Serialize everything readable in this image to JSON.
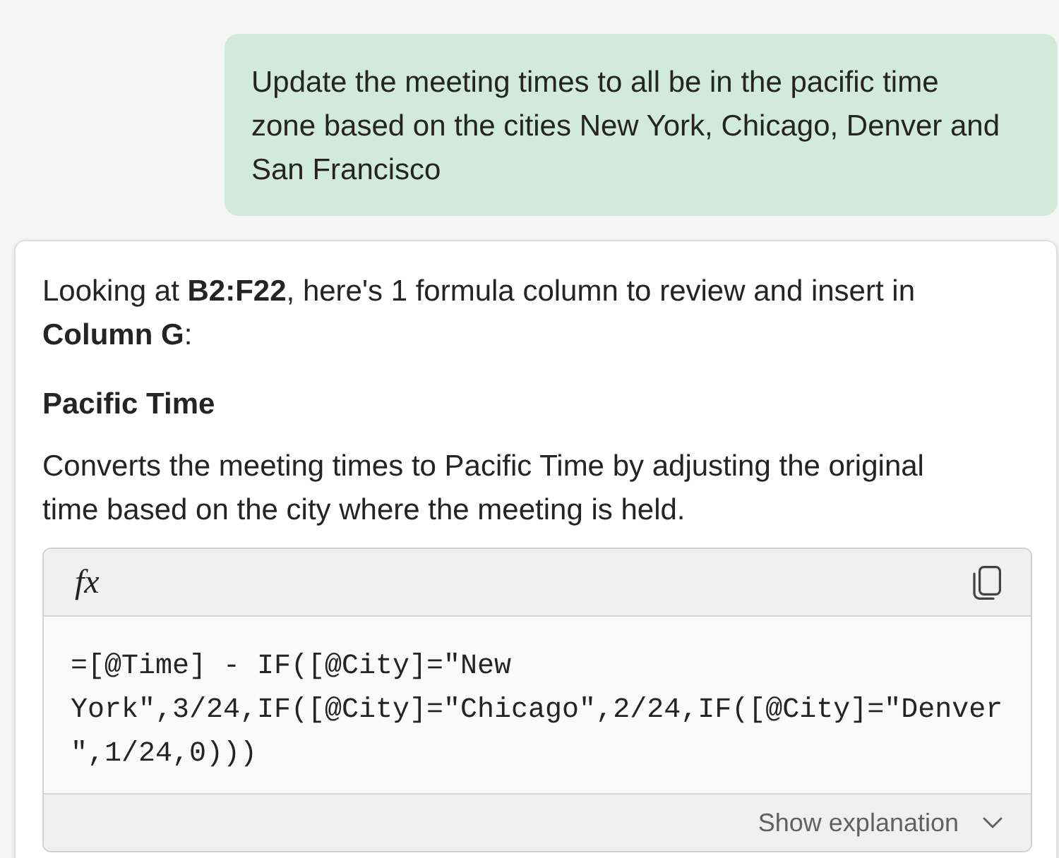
{
  "user_message": {
    "text": "Update the meeting times to all be in the pacific time zone based on the cities New York, Chicago, Denver and San Francisco"
  },
  "response": {
    "intro": "Looking at **B2:F22**, here's 1 formula column to review and insert in **Column G**:",
    "formula_title": "Pacific Time",
    "description": "Converts the meeting times to Pacific Time by adjusting the original time based on the city where the meeting is held.",
    "formula_card": {
      "icon_text": "fx",
      "formula": "=[@Time] - IF([@City]=\"New York\",3/24,IF([@City]=\"Chicago\",2/24,IF([@City]=\"Denver\",1/24,0)))",
      "explanation_toggle": {
        "label": "Show explanation",
        "expanded": false
      }
    }
  }
}
